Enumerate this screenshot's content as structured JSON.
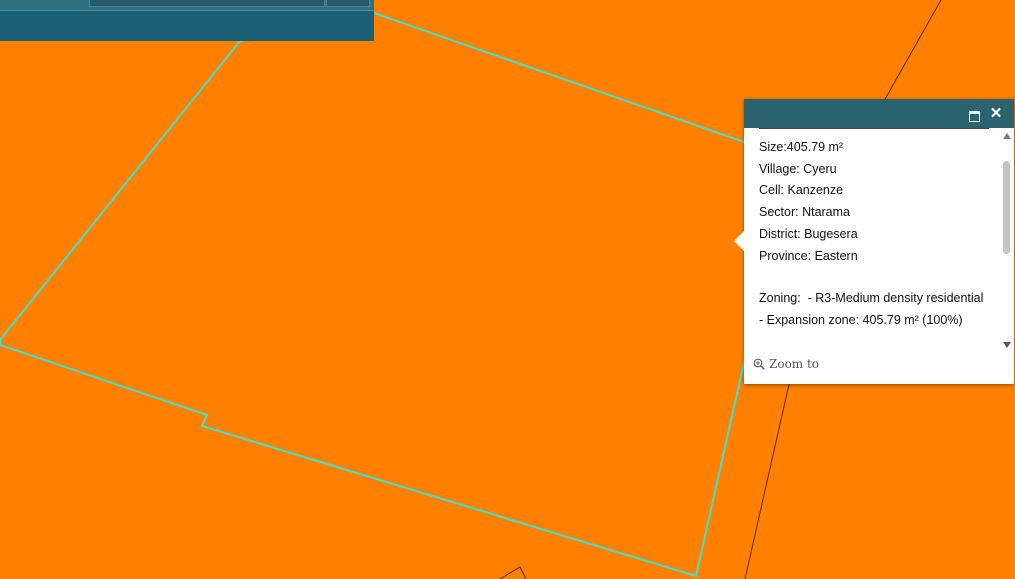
{
  "map": {
    "background_color": "#ff8000",
    "parcel_outline_color": "#40e0d0",
    "neighbor_line_color": "#5a2a00"
  },
  "toolbar": {
    "color": "#1c6076"
  },
  "popup": {
    "header_color": "#2b6371",
    "maximize_icon": "maximize-icon",
    "close_label": "✕",
    "lines": [
      "Size:405.79 m²",
      "Village: Cyeru",
      "Cell: Kanzenze",
      "Sector: Ntarama",
      "District: Bugesera",
      "Province: Eastern"
    ],
    "zoning_label": "Zoning:",
    "zoning_text": "  - R3-Medium density residential - Expansion zone: 405.79 m² (100%)",
    "zoom_label": "Zoom to"
  }
}
